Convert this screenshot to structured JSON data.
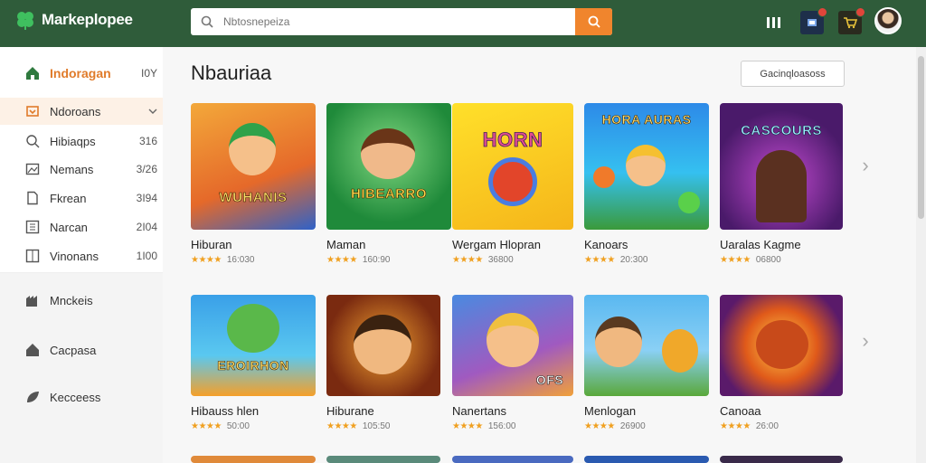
{
  "header": {
    "app_name": "Markeplopee",
    "search_placeholder": "Nbtosnepeiza"
  },
  "sidebar": {
    "items": [
      {
        "label": "Indoragan",
        "count": "I0Y"
      },
      {
        "label": "Ndoroans",
        "count": ""
      },
      {
        "label": "Hibiaqps",
        "count": "316"
      },
      {
        "label": "Nemans",
        "count": "3/26"
      },
      {
        "label": "Fkrean",
        "count": "3I94"
      },
      {
        "label": "Narcan",
        "count": "2I04"
      },
      {
        "label": "Vinonans",
        "count": "1I00"
      }
    ],
    "lower_items": [
      {
        "label": "Mnckeis"
      },
      {
        "label": "Cacpasa"
      },
      {
        "label": "Kecceess"
      }
    ]
  },
  "main": {
    "title": "Nbauriaa",
    "sort_label": "Gacinqloasoss",
    "row1": [
      {
        "title": "Hiburan",
        "count": "16:030",
        "thumb_text": "WUHANIS"
      },
      {
        "title": "Maman",
        "count": "160:90",
        "thumb_text": "HIBEARRO"
      },
      {
        "title": "Wergam Hlopran",
        "count": "36800",
        "thumb_text": "HORN"
      },
      {
        "title": "Kanoars",
        "count": "20:300",
        "thumb_text": "HORA AURAS"
      },
      {
        "title": "Uaralas Kagme",
        "count": "06800",
        "thumb_text": "CASCOURS"
      }
    ],
    "row2": [
      {
        "title": "Hibauss hlen",
        "count": "50:00",
        "thumb_text": "EROIRHON"
      },
      {
        "title": "Hiburane",
        "count": "105:50",
        "thumb_text": ""
      },
      {
        "title": "Nanertans",
        "count": "156:00",
        "thumb_text": "OFS"
      },
      {
        "title": "Menlogan",
        "count": "26900",
        "thumb_text": ""
      },
      {
        "title": "Canoaa",
        "count": "26:00",
        "thumb_text": ""
      }
    ],
    "stars": "★★★★"
  },
  "colors": {
    "header_bg": "#2f5c3a",
    "accent": "#f0852d",
    "star": "#f0a020"
  }
}
